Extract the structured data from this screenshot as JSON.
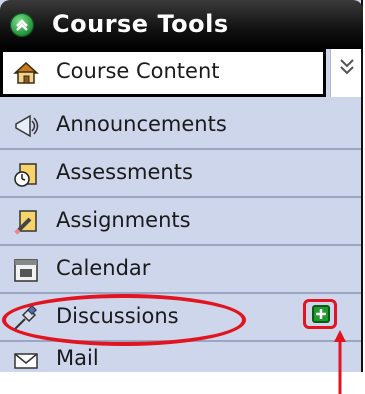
{
  "header": {
    "title": "Course Tools",
    "toggle_icon": "collapse-icon"
  },
  "menu": {
    "items": [
      {
        "label": "Course Content",
        "icon": "home-icon"
      },
      {
        "label": "Announcements",
        "icon": "megaphone-icon"
      },
      {
        "label": "Assessments",
        "icon": "assessment-clipboard-icon"
      },
      {
        "label": "Assignments",
        "icon": "assignment-pencil-icon"
      },
      {
        "label": "Calendar",
        "icon": "calendar-icon"
      },
      {
        "label": "Discussions",
        "icon": "pushpin-icon"
      },
      {
        "label": "Mail",
        "icon": "envelope-icon"
      }
    ],
    "selected_index": 0,
    "expand_icon": "double-chevron-down-icon",
    "add_icon": "plus-icon"
  },
  "colors": {
    "panel_bg": "#cdd6ea",
    "header_bg": "#111111",
    "annotation_red": "#e1141f",
    "add_button_green": "#1f9a2c"
  }
}
